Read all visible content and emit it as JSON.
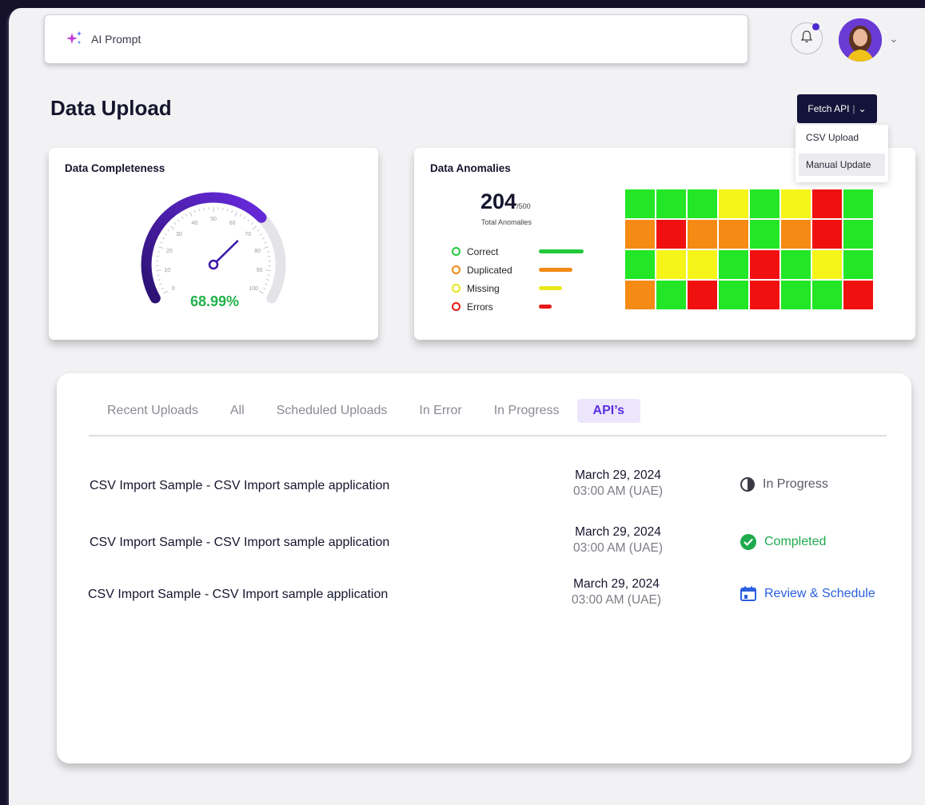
{
  "header": {
    "prompt_label": "AI Prompt",
    "prompt_icon": "sparkle-icon",
    "bell_icon": "bell-icon"
  },
  "page": {
    "title": "Data Upload"
  },
  "fetch": {
    "label": "Fetch API",
    "options": [
      "CSV Upload",
      "Manual Update"
    ],
    "selected": "Manual Update"
  },
  "completeness": {
    "title": "Data Completeness",
    "value_label": "68.99%",
    "value": 68.99,
    "ticks": [
      "0",
      "10",
      "20",
      "30",
      "40",
      "50",
      "60",
      "70",
      "80",
      "90",
      "100"
    ]
  },
  "anomalies": {
    "title": "Data Anomalies",
    "total": "204",
    "max": "/500",
    "subtitle": "Total Anomalies",
    "legend": [
      {
        "label": "Correct",
        "color": "#22c93a",
        "fraction": 1.0
      },
      {
        "label": "Duplicated",
        "color": "#f28a14",
        "fraction": 0.75
      },
      {
        "label": "Missing",
        "color": "#e8e81a",
        "fraction": 0.52
      },
      {
        "label": "Errors",
        "color": "#e81818",
        "fraction": 0.29
      }
    ],
    "heatmap": [
      [
        "g",
        "g",
        "g",
        "y",
        "g",
        "y",
        "r",
        "g"
      ],
      [
        "o",
        "r",
        "o",
        "o",
        "g",
        "o",
        "r",
        "g"
      ],
      [
        "g",
        "y",
        "y",
        "g",
        "r",
        "g",
        "y",
        "g"
      ],
      [
        "o",
        "g",
        "r",
        "g",
        "r",
        "g",
        "g",
        "r"
      ]
    ],
    "colors": {
      "g": "#22e626",
      "y": "#f5f51a",
      "r": "#f01010",
      "o": "#f58a14"
    }
  },
  "tabs": [
    {
      "label": "Recent Uploads",
      "active": false
    },
    {
      "label": "All",
      "active": false
    },
    {
      "label": "Scheduled Uploads",
      "active": false
    },
    {
      "label": "In Error",
      "active": false
    },
    {
      "label": "In Progress",
      "active": false
    },
    {
      "label": "API’s",
      "active": true
    }
  ],
  "uploads": [
    {
      "title": "CSV Import Sample - CSV Import sample application",
      "date": "March 29, 2024",
      "time": "03:00 AM (UAE)",
      "status": "In Progress",
      "status_icon": "half-circle-icon",
      "status_color": "#5a5a66"
    },
    {
      "title": "CSV Import Sample - CSV Import sample application",
      "date": "March 29, 2024",
      "time": "03:00 AM (UAE)",
      "status": "Completed",
      "status_icon": "check-circle-icon",
      "status_color": "#1faa4c"
    },
    {
      "title": "CSV Import Sample - CSV Import sample application",
      "date": "March 29, 2024",
      "time": "03:00 AM (UAE)",
      "status": "Review & Schedule",
      "status_icon": "calendar-icon",
      "status_color": "#2a5fe0"
    }
  ]
}
